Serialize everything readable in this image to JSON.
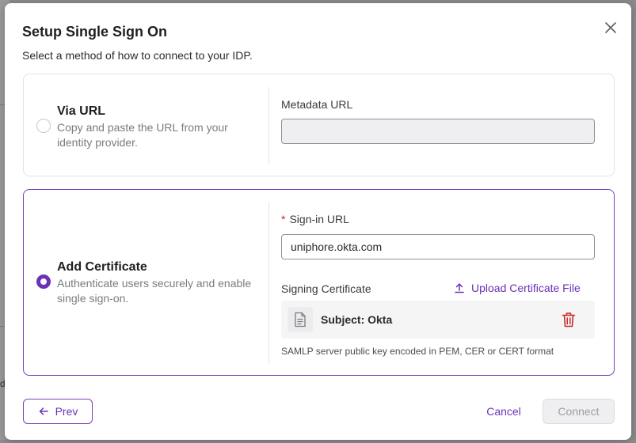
{
  "modal": {
    "title": "Setup Single Sign On",
    "subtitle": "Select a method of how to connect to your IDP."
  },
  "options": {
    "via_url": {
      "title": "Via URL",
      "description": "Copy and paste the URL from your identity provider.",
      "selected": false,
      "metadata_label": "Metadata URL",
      "metadata_value": ""
    },
    "add_certificate": {
      "title": "Add Certificate",
      "description": "Authenticate users securely and enable single sign-on.",
      "selected": true,
      "required_mark": "*",
      "signin_label": "Sign-in URL",
      "signin_value": "uniphore.okta.com",
      "signing_label": "Signing Certificate",
      "upload_label": "Upload Certificate File",
      "file_name": "Subject: Okta",
      "helper": "SAMLP server public key encoded in PEM, CER or CERT format"
    }
  },
  "footer": {
    "prev_label": "Prev",
    "cancel_label": "Cancel",
    "connect_label": "Connect"
  },
  "colors": {
    "accent": "#6b32b5",
    "danger": "#c62828",
    "disabled_bg": "#efeff1"
  },
  "icons": [
    "close-icon",
    "upload-icon",
    "document-icon",
    "trash-icon",
    "arrow-left-icon"
  ],
  "background": {
    "edge_letter": "d"
  }
}
